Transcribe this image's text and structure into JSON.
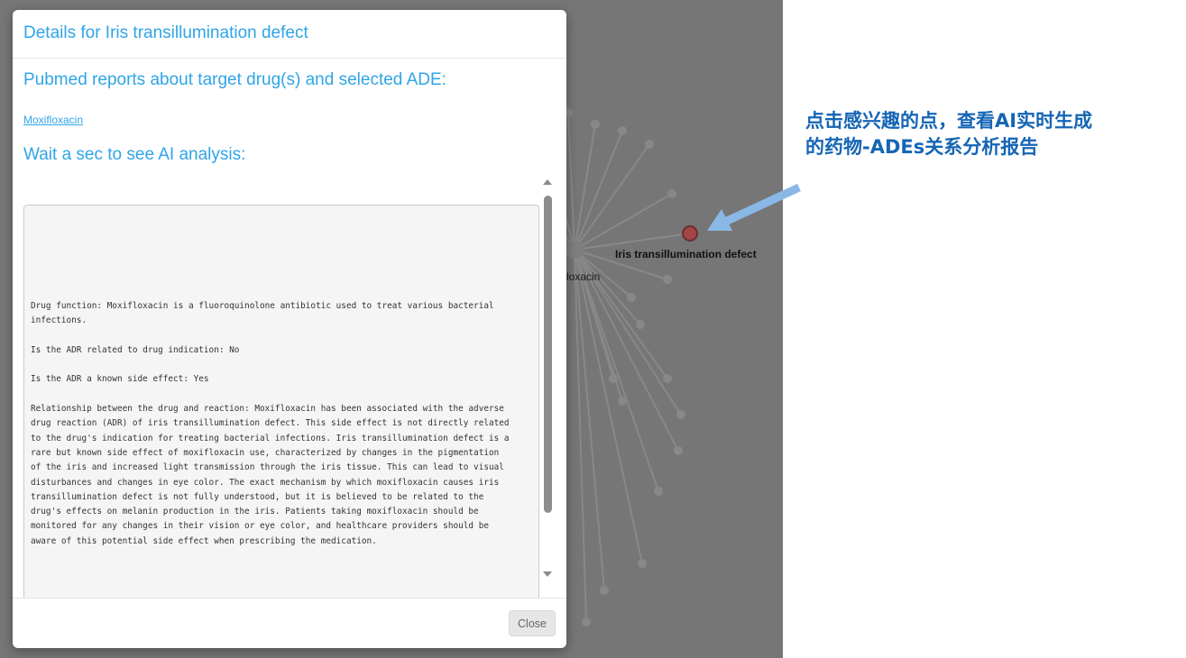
{
  "modal": {
    "title": "Details for Iris transillumination defect",
    "pubmed_heading": "Pubmed reports about target drug(s) and selected ADE:",
    "drug_link": "Moxifloxacin",
    "ai_heading": "Wait a sec to see AI analysis:",
    "analysis_text": "Drug function: Moxifloxacin is a fluoroquinolone antibiotic used to treat various bacterial\ninfections.\n\nIs the ADR related to drug indication: No\n\nIs the ADR a known side effect: Yes\n\nRelationship between the drug and reaction: Moxifloxacin has been associated with the adverse\ndrug reaction (ADR) of iris transillumination defect. This side effect is not directly related\nto the drug's indication for treating bacterial infections. Iris transillumination defect is a\nrare but known side effect of moxifloxacin use, characterized by changes in the pigmentation\nof the iris and increased light transmission through the iris tissue. This can lead to visual\ndisturbances and changes in eye color. The exact mechanism by which moxifloxacin causes iris\ntransillumination defect is not fully understood, but it is believed to be related to the\ndrug's effects on melanin production in the iris. Patients taking moxifloxacin should be\nmonitored for any changes in their vision or eye color, and healthcare providers should be\naware of this potential side effect when prescribing the medication.",
    "close_label": "Close"
  },
  "graph": {
    "selected_node_label": "Iris transillumination defect",
    "drug_node_label": "loxacin",
    "selected_node_color": "#c0393b"
  },
  "annotation": {
    "line1": "点击感兴趣的点，查看AI实时生成",
    "line2": "的药物-ADEs关系分析报告",
    "color": "#1565b5"
  },
  "colors": {
    "accent": "#2fa4e7",
    "backdrop": "#767676",
    "arrow": "#8ab8e6"
  }
}
